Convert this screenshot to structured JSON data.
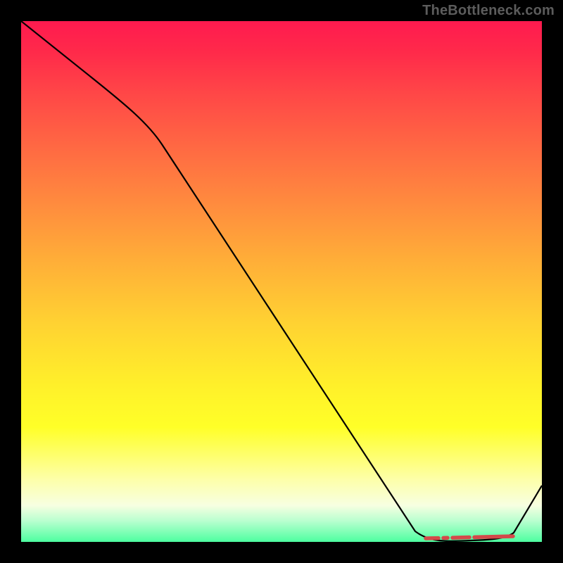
{
  "watermark": "TheBottleneck.com",
  "chart_data": {
    "type": "line",
    "title": "",
    "xlabel": "",
    "ylabel": "",
    "xlim": [
      0,
      100
    ],
    "ylim": [
      0,
      100
    ],
    "grid": false,
    "legend": false,
    "series": [
      {
        "name": "curve",
        "x": [
          0,
          12,
          25,
          40,
          55,
          70,
          80,
          85,
          90,
          95,
          100
        ],
        "y": [
          100,
          89,
          77,
          56,
          35,
          14,
          1,
          0,
          0,
          2,
          12
        ]
      }
    ],
    "markers": {
      "name": "bottom-dash",
      "y": 1.5,
      "x_start": 80,
      "x_end": 95,
      "color": "#d44a4a"
    },
    "background_gradient": [
      {
        "pos": 0.0,
        "color": "#ff1a4f"
      },
      {
        "pos": 0.35,
        "color": "#ff8b3e"
      },
      {
        "pos": 0.7,
        "color": "#fff02a"
      },
      {
        "pos": 1.0,
        "color": "#4dffa0"
      }
    ]
  }
}
